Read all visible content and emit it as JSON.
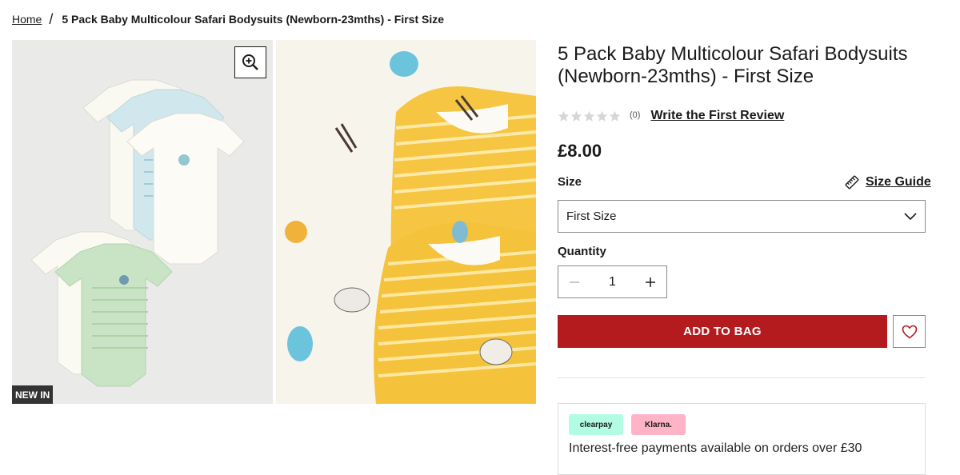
{
  "breadcrumb": {
    "home": "Home",
    "separator": "/",
    "current": "5 Pack Baby Multicolour Safari Bodysuits (Newborn-23mths) - First Size"
  },
  "gallery": {
    "badge": "NEW IN",
    "zoom_icon": "zoom-in-icon"
  },
  "product": {
    "title": "5 Pack Baby Multicolour Safari Bodysuits (Newborn-23mths) - First Size",
    "rating": {
      "stars": 0,
      "max_stars": 5,
      "count_text": "(0)",
      "review_link": "Write the First Review"
    },
    "price": "£8.00",
    "size_label": "Size",
    "size_guide": "Size Guide",
    "size_selected": "First Size",
    "quantity_label": "Quantity",
    "quantity_value": "1",
    "add_to_bag": "ADD TO BAG"
  },
  "payments": {
    "clearpay": "clearpay",
    "klarna": "Klarna.",
    "text": "Interest-free payments available on orders over £30"
  },
  "colors": {
    "accent": "#b31b1e",
    "clearpay_bg": "#b2fce4",
    "klarna_bg": "#ffb3c7"
  }
}
